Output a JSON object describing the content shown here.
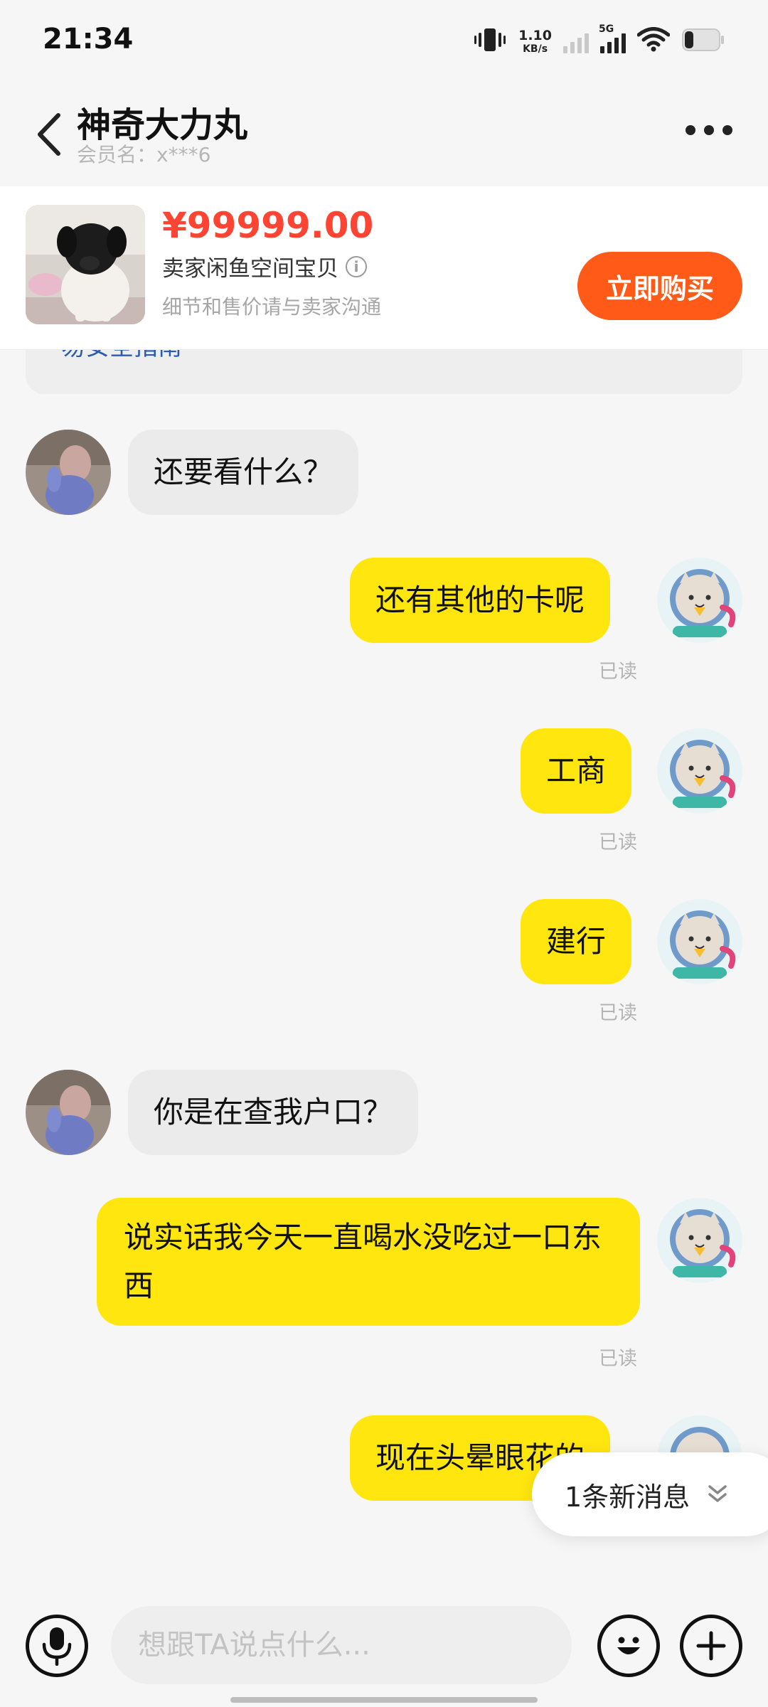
{
  "status_bar": {
    "time": "21:34",
    "net_speed_value": "1.10",
    "net_speed_unit": "KB/s",
    "network_label": "5G",
    "icons": [
      "vibrate-icon",
      "signal-icon",
      "signal-5g-icon",
      "wifi-icon",
      "battery-icon"
    ]
  },
  "header": {
    "title": "神奇大力丸",
    "member_name": "会员名：x***6",
    "back_icon": "chevron-left-icon",
    "more_icon": "more-dots-icon"
  },
  "product": {
    "price": "¥99999.00",
    "item_type": "卖家闲鱼空间宝贝",
    "note": "细节和售价请与卖家沟通",
    "buy_label": "立即购买",
    "thumb_icon": "puppy-photo"
  },
  "notice": {
    "partial_text": "易安全指南"
  },
  "messages": [
    {
      "side": "in",
      "text": "还要看什么？"
    },
    {
      "side": "out",
      "text": "还有其他的卡呢",
      "status": "已读"
    },
    {
      "side": "out",
      "text": "工商",
      "status": "已读"
    },
    {
      "side": "out",
      "text": "建行",
      "status": "已读"
    },
    {
      "side": "in",
      "text": "你是在查我户口？"
    },
    {
      "side": "out",
      "text": "说实话我今天一直喝水没吃过一口东西",
      "status": "已读"
    },
    {
      "side": "out",
      "text": "现在头晕眼花的"
    }
  ],
  "new_message": {
    "label": "1条新消息",
    "icon": "double-chevron-down-icon"
  },
  "input_bar": {
    "placeholder": "想跟TA说点什么...",
    "voice_icon": "microphone-icon",
    "emoji_icon": "emoji-icon",
    "add_icon": "plus-icon"
  },
  "colors": {
    "accent": "#ff5a17",
    "price": "#ff4433",
    "outgoing_bubble": "#ffe60f",
    "incoming_bubble": "#ebebeb"
  }
}
